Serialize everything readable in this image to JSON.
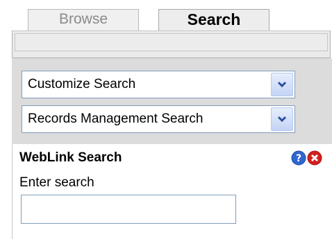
{
  "tabs": [
    {
      "label": "Browse",
      "active": false
    },
    {
      "label": "Search",
      "active": true
    }
  ],
  "dropdowns": {
    "customize": {
      "value": "Customize Search"
    },
    "template": {
      "value": "Records Management Search"
    }
  },
  "search_panel": {
    "title": "WebLink Search",
    "input_label": "Enter search",
    "input_value": "",
    "help_icon": "help-icon",
    "close_icon": "close-icon"
  },
  "colors": {
    "help": "#2f66d0",
    "close": "#d32020",
    "select_border": "#7f9db9",
    "panel_grey": "#dcdcdc"
  }
}
